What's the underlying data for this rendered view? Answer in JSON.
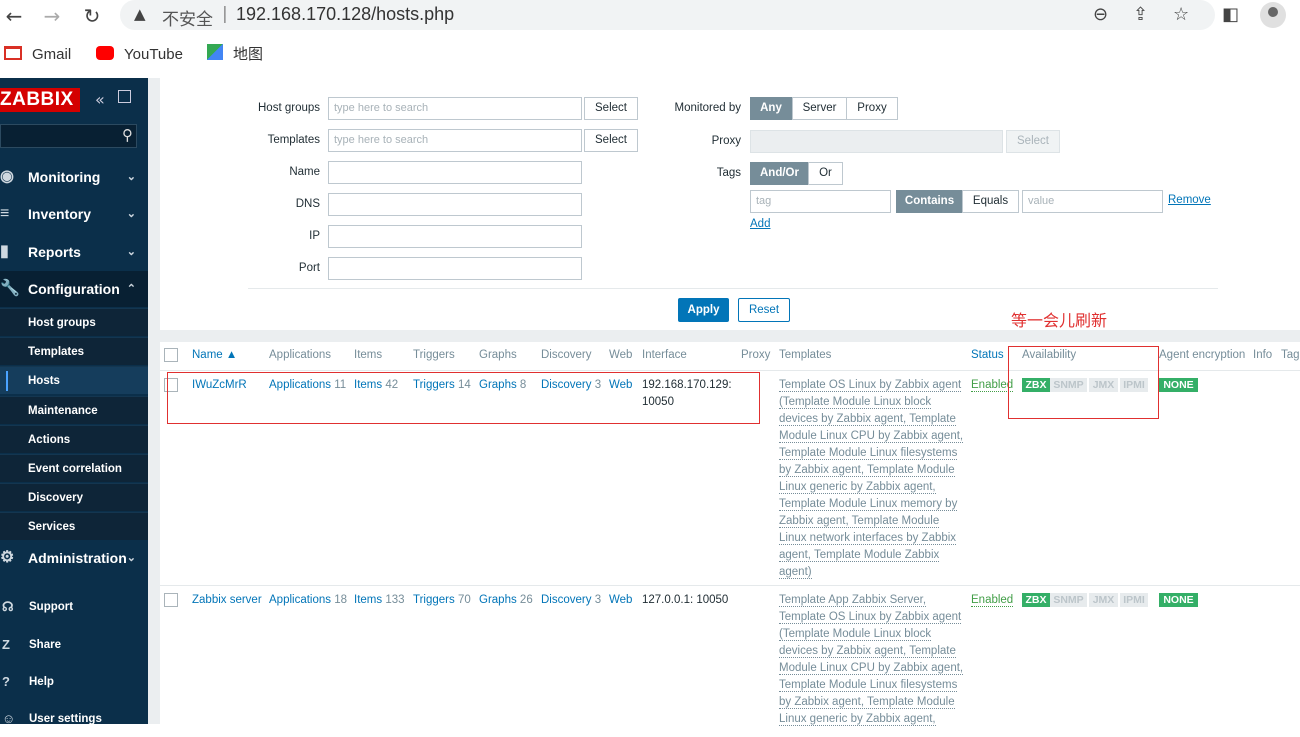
{
  "browser": {
    "warning": "不安全",
    "separator": "|",
    "url": "192.168.170.128/hosts.php",
    "bookmarks": [
      {
        "label": "Gmail",
        "icon": "gmail-icon",
        "color": "#d93025"
      },
      {
        "label": "YouTube",
        "icon": "youtube-icon",
        "color": "#ff0000"
      },
      {
        "label": "地图",
        "icon": "maps-icon",
        "color": "#34a853"
      }
    ]
  },
  "sidebar": {
    "logo": "ZABBIX",
    "menu": [
      {
        "label": "Monitoring",
        "icon": "eye-icon"
      },
      {
        "label": "Inventory",
        "icon": "list-icon"
      },
      {
        "label": "Reports",
        "icon": "bar-chart-icon"
      },
      {
        "label": "Configuration",
        "icon": "wrench-icon"
      },
      {
        "label": "Administration",
        "icon": "gear-icon"
      }
    ],
    "submenu": [
      "Host groups",
      "Templates",
      "Hosts",
      "Maintenance",
      "Actions",
      "Event correlation",
      "Discovery",
      "Services"
    ],
    "active_submenu": "Hosts",
    "footer": [
      {
        "label": "Support",
        "icon": "headset-icon"
      },
      {
        "label": "Share",
        "icon": "share-icon"
      },
      {
        "label": "Help",
        "icon": "help-icon"
      },
      {
        "label": "User settings",
        "icon": "user-icon"
      }
    ]
  },
  "filter": {
    "host_groups_label": "Host groups",
    "templates_label": "Templates",
    "name_label": "Name",
    "dns_label": "DNS",
    "ip_label": "IP",
    "port_label": "Port",
    "search_placeholder": "type here to search",
    "select_label": "Select",
    "monitored_by_label": "Monitored by",
    "monitored_by_options": [
      "Any",
      "Server",
      "Proxy"
    ],
    "proxy_label": "Proxy",
    "tags_label": "Tags",
    "tags_logic": [
      "And/Or",
      "Or"
    ],
    "tag_placeholder": "tag",
    "tag_ops": [
      "Contains",
      "Equals"
    ],
    "value_placeholder": "value",
    "remove_label": "Remove",
    "add_label": "Add",
    "apply_label": "Apply",
    "reset_label": "Reset"
  },
  "table": {
    "columns": [
      "Name ▲",
      "Applications",
      "Items",
      "Triggers",
      "Graphs",
      "Discovery",
      "Web",
      "Interface",
      "Proxy",
      "Templates",
      "Status",
      "Availability",
      "Agent encryption",
      "Info",
      "Tag"
    ],
    "rows": [
      {
        "name": "IWuZcMrR",
        "applications": "Applications",
        "applications_count": "11",
        "items": "Items",
        "items_count": "42",
        "triggers": "Triggers",
        "triggers_count": "14",
        "graphs": "Graphs",
        "graphs_count": "8",
        "discovery": "Discovery",
        "discovery_count": "3",
        "web": "Web",
        "interface_line1": "192.168.170.129:",
        "interface_line2": "10050",
        "templates": [
          "Template OS Linux by Zabbix agent",
          "(Template Module Linux block",
          "devices by Zabbix agent, Template",
          "Module Linux CPU by Zabbix agent,",
          "Template Module Linux filesystems",
          "by Zabbix agent, Template Module",
          "Linux generic by Zabbix agent,",
          "Template Module Linux memory by",
          "Zabbix agent, Template Module",
          "Linux network interfaces by Zabbix",
          "agent, Template Module Zabbix",
          "agent)"
        ],
        "status": "Enabled",
        "availability": [
          "ZBX",
          "SNMP",
          "JMX",
          "IPMI"
        ],
        "encryption": "NONE"
      },
      {
        "name": "Zabbix server",
        "applications": "Applications",
        "applications_count": "18",
        "items": "Items",
        "items_count": "133",
        "triggers": "Triggers",
        "triggers_count": "70",
        "graphs": "Graphs",
        "graphs_count": "26",
        "discovery": "Discovery",
        "discovery_count": "3",
        "web": "Web",
        "interface_line1": "127.0.0.1: 10050",
        "templates": [
          "Template App Zabbix Server,",
          "Template OS Linux by Zabbix agent",
          "(Template Module Linux block",
          "devices by Zabbix agent, Template",
          "Module Linux CPU by Zabbix agent,",
          "Template Module Linux filesystems",
          "by Zabbix agent, Template Module",
          "Linux generic by Zabbix agent,"
        ],
        "status": "Enabled",
        "availability": [
          "ZBX",
          "SNMP",
          "JMX",
          "IPMI"
        ],
        "encryption": "NONE"
      }
    ]
  },
  "annotation": {
    "text": "等一会儿刷新",
    "color": "#e03030"
  }
}
